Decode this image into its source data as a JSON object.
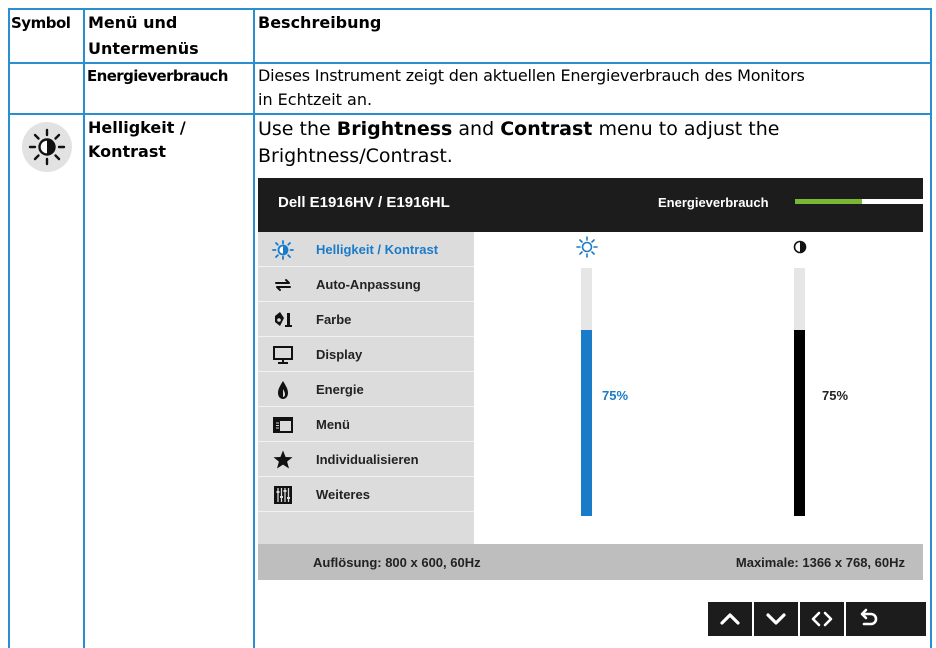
{
  "header": {
    "symbol": "Symbol",
    "menu_line1": "Menü und",
    "menu_line2": "Untermenüs",
    "description": "Beschreibung"
  },
  "row_energy": {
    "menu": "Energieverbrauch",
    "description_line1": "Dieses Instrument zeigt den aktuellen Energieverbrauch des Monitors",
    "description_line2": "in Echtzeit an."
  },
  "row_brightness": {
    "symbol_icon": "brightness-icon",
    "menu_line1": "Helligkeit /",
    "menu_line2": "Kontrast",
    "desc_part1": "Use the ",
    "desc_bold1": "Brightness",
    "desc_part2": " and ",
    "desc_bold2": "Contrast",
    "desc_part3": " menu to adjust the",
    "desc_line2": "Brightness/Contrast."
  },
  "osd": {
    "title": "Dell E1916HV / E1916HL",
    "energy_label": "Energieverbrauch",
    "energy_level": 0.52,
    "menu_items": [
      {
        "label": "Helligkeit / Kontrast",
        "icon": "brightness-icon"
      },
      {
        "label": "Auto-Anpassung",
        "icon": "auto-adjust-icon"
      },
      {
        "label": "Farbe",
        "icon": "color-icon"
      },
      {
        "label": "Display",
        "icon": "display-icon"
      },
      {
        "label": "Energie",
        "icon": "energy-icon"
      },
      {
        "label": "Menü",
        "icon": "menu-icon"
      },
      {
        "label": "Individualisieren",
        "icon": "star-icon"
      },
      {
        "label": "Weiteres",
        "icon": "others-icon"
      }
    ],
    "brightness": {
      "value": 75,
      "label": "75%",
      "icon": "sun-icon"
    },
    "contrast": {
      "value": 75,
      "label": "75%",
      "icon": "contrast-icon"
    },
    "resolution": "Auflösung: 800 x 600, 60Hz",
    "maximum": "Maximale: 1366 x 768, 60Hz",
    "nav_buttons": [
      "up-arrow-icon",
      "down-arrow-icon",
      "left-right-icon",
      "back-icon"
    ],
    "accent_color": "#1a7bc9",
    "energy_color": "#7ab733"
  }
}
